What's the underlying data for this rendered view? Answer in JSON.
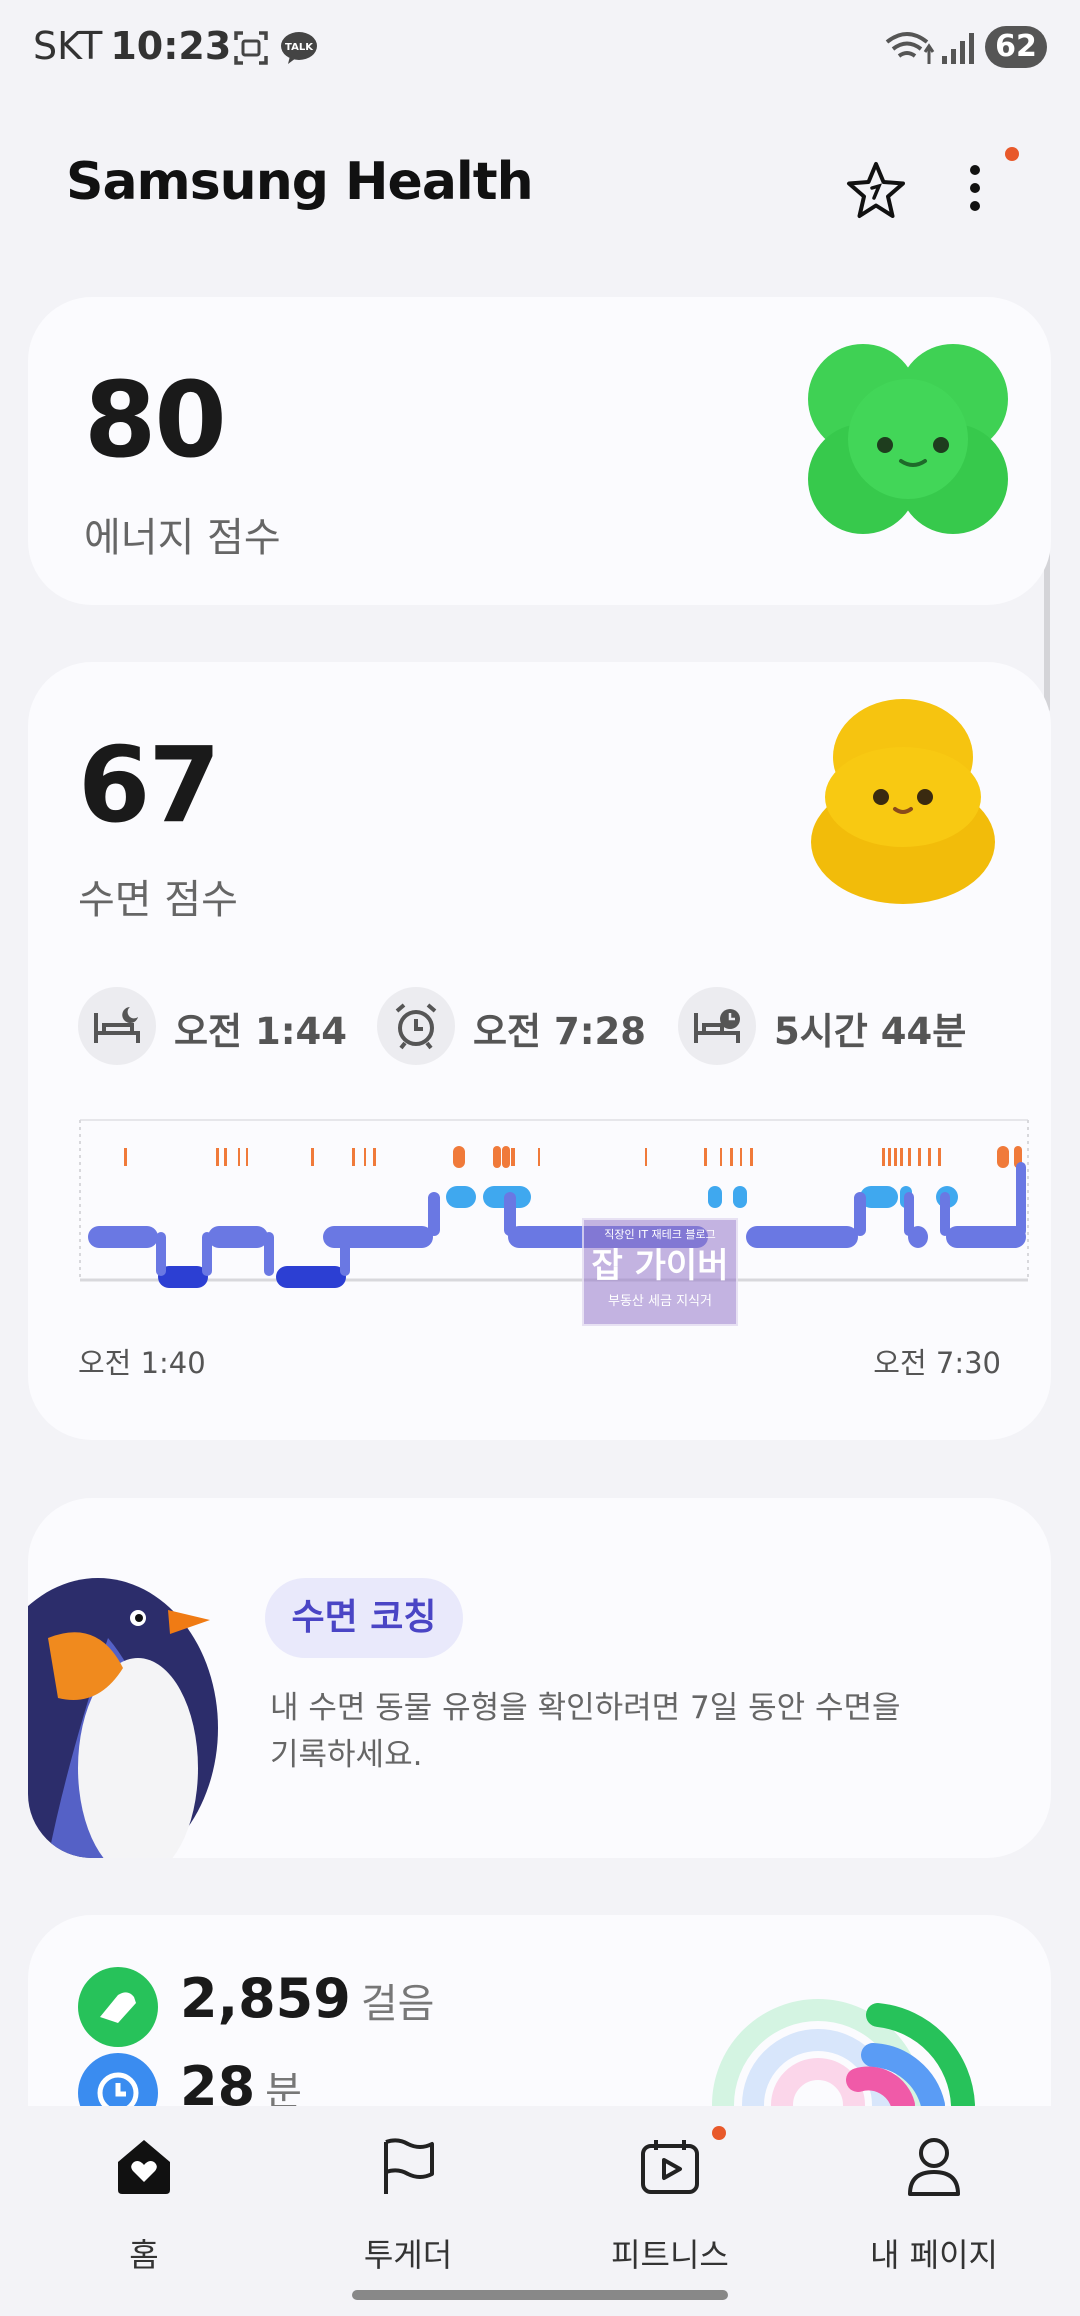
{
  "status_bar": {
    "carrier": "SKT",
    "time": "10:23",
    "notification_icons": [
      "screenshot-icon",
      "kakaotalk-icon"
    ],
    "talk_badge": "TALK",
    "battery": "62"
  },
  "header": {
    "title": "Samsung Health",
    "icons": [
      "favorite-star-icon",
      "more-options-icon"
    ]
  },
  "energy": {
    "score": "80",
    "label": "에너지 점수"
  },
  "sleep": {
    "score": "67",
    "label": "수면 점수",
    "bedtime": "오전 1:44",
    "wake_time": "오전 7:28",
    "duration": "5시간 44분",
    "start_label": "오전 1:40",
    "end_label": "오전 7:30",
    "colors": {
      "awake": "#f07a3a",
      "rem": "#3fa8ef",
      "light": "#6a78e3",
      "deep": "#2c3fd3"
    }
  },
  "coaching": {
    "title": "수면 코칭",
    "description": "내 수면 동물 유형을 확인하려면 7일 동안 수면을 기록하세요."
  },
  "activity": {
    "steps": "2,859",
    "steps_unit": "걸음",
    "minutes": "28",
    "minutes_unit": "분"
  },
  "watermark": {
    "top": "직장인 IT 재테크 블로그",
    "main": "잡 가이버",
    "bottom": "부동산 세금 지식거"
  },
  "bottom_nav": [
    {
      "label": "홈",
      "icon": "home-icon",
      "active": true
    },
    {
      "label": "투게더",
      "icon": "flag-icon",
      "active": false
    },
    {
      "label": "피트니스",
      "icon": "fitness-video-icon",
      "active": false
    },
    {
      "label": "내 페이지",
      "icon": "profile-icon",
      "active": false
    }
  ]
}
